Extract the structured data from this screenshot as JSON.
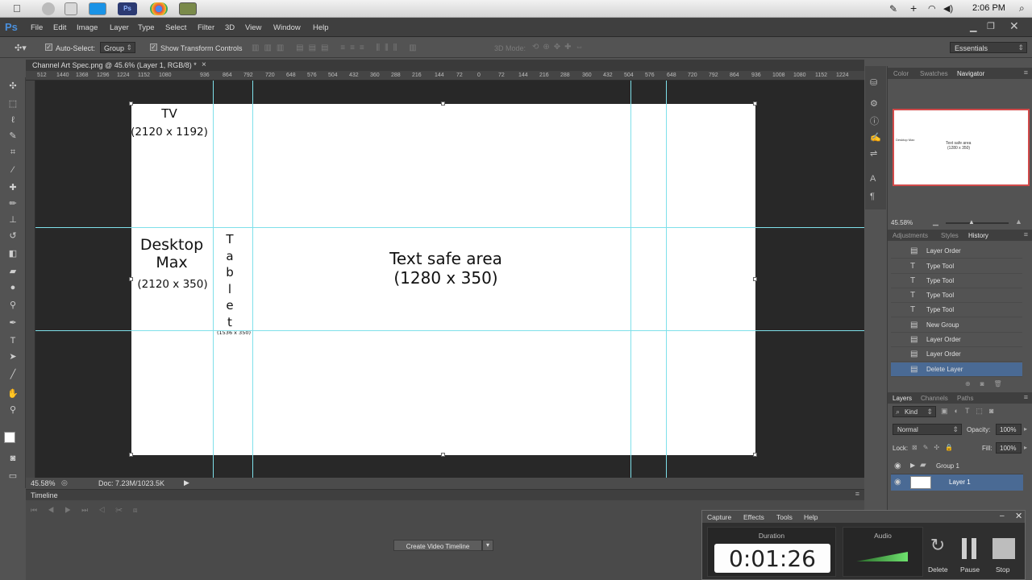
{
  "mac_menubar": {
    "apple_icon": "apple-logo-icon",
    "time": "2:06 PM",
    "icons": [
      "notes-icon",
      "plus-icon",
      "wifi-icon",
      "volume-icon",
      "search-icon"
    ]
  },
  "ps_menu": {
    "logo": "Ps",
    "items": [
      "File",
      "Edit",
      "Image",
      "Layer",
      "Type",
      "Select",
      "Filter",
      "3D",
      "View",
      "Window",
      "Help"
    ],
    "workspace": "Essentials"
  },
  "options_bar": {
    "auto_select_label": "Auto-Select:",
    "auto_select_value": "Group",
    "show_transform_label": "Show Transform Controls",
    "mode_3d_label": "3D Mode:"
  },
  "document": {
    "tab_title": "Channel Art Spec.png @ 45.6% (Layer 1, RGB/8) *",
    "close_glyph": "×",
    "ruler_ticks": [
      "512",
      "1440",
      "1368",
      "1296",
      "1224",
      "1152",
      "1080",
      "936",
      "864",
      "792",
      "720",
      "648",
      "576",
      "504",
      "432",
      "360",
      "288",
      "216",
      "144",
      "72",
      "0",
      "72",
      "144",
      "216",
      "288",
      "360",
      "432",
      "504",
      "576",
      "648",
      "720",
      "792",
      "864",
      "936",
      "1008",
      "1080",
      "1152",
      "1224"
    ],
    "tv_line1": "TV",
    "tv_line2": "(2120 x 1192)",
    "desktop_line1": "Desktop",
    "desktop_line2": "Max",
    "desktop_line3": "(2120 x 350)",
    "tablet_letters": [
      "T",
      "a",
      "b",
      "l",
      "e",
      "t"
    ],
    "tablet_size": "(1536 x 350)",
    "safe_line1": "Text safe area",
    "safe_line2": "(1280 x 350)"
  },
  "status": {
    "zoom": "45.58%",
    "doc_size": "Doc: 7.23M/1023.5K"
  },
  "timeline": {
    "title": "Timeline",
    "create_button": "Create Video Timeline"
  },
  "panels": {
    "color_tabs": [
      "Color",
      "Swatches",
      "Navigator"
    ],
    "navigator_zoom": "45.58%",
    "nav_thumb_text1": "Text safe area",
    "nav_thumb_text2": "(1280 x 350)",
    "nav_thumb_desktop": "Desktop Max",
    "history_tabs": [
      "Adjustments",
      "Styles",
      "History"
    ],
    "history_items": [
      {
        "icon": "layer-order-icon",
        "label": "Layer Order"
      },
      {
        "icon": "type-tool-icon",
        "label": "Type Tool"
      },
      {
        "icon": "type-tool-icon",
        "label": "Type Tool"
      },
      {
        "icon": "type-tool-icon",
        "label": "Type Tool"
      },
      {
        "icon": "type-tool-icon",
        "label": "Type Tool"
      },
      {
        "icon": "new-group-icon",
        "label": "New Group"
      },
      {
        "icon": "layer-order-icon",
        "label": "Layer Order"
      },
      {
        "icon": "layer-order-icon",
        "label": "Layer Order"
      },
      {
        "icon": "delete-layer-icon",
        "label": "Delete Layer"
      }
    ],
    "layers_tabs": [
      "Layers",
      "Channels",
      "Paths"
    ],
    "kind_label": "Kind",
    "blend_mode": "Normal",
    "opacity_label": "Opacity:",
    "opacity_value": "100%",
    "lock_label": "Lock:",
    "fill_label": "Fill:",
    "fill_value": "100%",
    "layers": [
      {
        "name": "Group 1",
        "type": "group"
      },
      {
        "name": "Layer 1",
        "type": "layer"
      }
    ]
  },
  "capture": {
    "menu": [
      "Capture",
      "Effects",
      "Tools",
      "Help"
    ],
    "duration_label": "Duration",
    "duration_value": "0:01:26",
    "audio_label": "Audio",
    "delete_label": "Delete",
    "pause_label": "Pause",
    "stop_label": "Stop"
  },
  "colors": {
    "guide": "#7fe0ea",
    "selected_row": "#4a6a94",
    "ps_blue": "#3c6fb4"
  }
}
